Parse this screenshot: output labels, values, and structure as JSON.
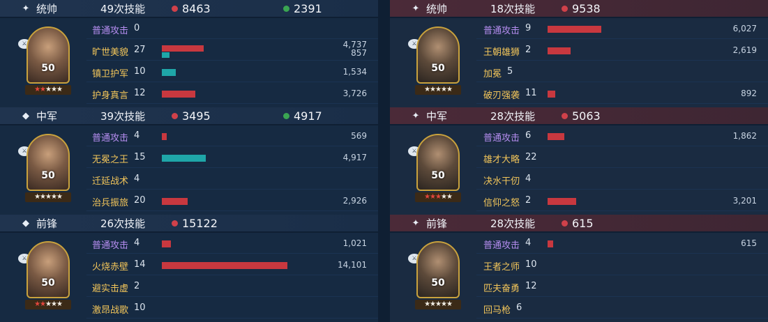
{
  "colors": {
    "damage": "#d0414a",
    "heal": "#3aa552",
    "skill_bar": "#c8383f",
    "heal_bar": "#1fa6a8",
    "normal_attack": "#b58df0",
    "skill_name": "#f2c55a"
  },
  "max_bar_value": 14101,
  "left": [
    {
      "role": "统帅",
      "role_icon": "star-icon",
      "casts": "49次技能",
      "damage": "8463",
      "heal": "2391",
      "level": "50",
      "stars_on": 2,
      "stars_total": 5,
      "skills": [
        {
          "name": "普通攻击",
          "count": "0",
          "type": "normal",
          "dmg": null,
          "heal": null
        },
        {
          "name": "旷世美貌",
          "count": "27",
          "type": "skill",
          "dmg": 4737,
          "heal": 857,
          "dmg_text": "4,737",
          "heal_text": "857"
        },
        {
          "name": "镇卫护军",
          "count": "10",
          "type": "skill",
          "dmg": null,
          "heal": 1534,
          "heal_text": "1,534"
        },
        {
          "name": "护身真言",
          "count": "12",
          "type": "skill",
          "dmg": 3726,
          "heal": null,
          "dmg_text": "3,726"
        }
      ]
    },
    {
      "role": "中军",
      "role_icon": "diamond-icon",
      "casts": "39次技能",
      "damage": "3495",
      "heal": "4917",
      "level": "50",
      "stars_on": 0,
      "stars_total": 5,
      "skills": [
        {
          "name": "普通攻击",
          "count": "4",
          "type": "normal",
          "dmg": 569,
          "heal": null,
          "dmg_text": "569"
        },
        {
          "name": "无冕之王",
          "count": "15",
          "type": "skill",
          "dmg": null,
          "heal": 4917,
          "heal_text": "4,917"
        },
        {
          "name": "迁延战术",
          "count": "4",
          "type": "skill",
          "dmg": null,
          "heal": null
        },
        {
          "name": "治兵振旅",
          "count": "20",
          "type": "skill",
          "dmg": 2926,
          "heal": null,
          "dmg_text": "2,926"
        }
      ]
    },
    {
      "role": "前锋",
      "role_icon": "diamond-icon",
      "casts": "26次技能",
      "damage": "15122",
      "heal": null,
      "level": "50",
      "stars_on": 2,
      "stars_total": 5,
      "skills": [
        {
          "name": "普通攻击",
          "count": "4",
          "type": "normal",
          "dmg": 1021,
          "heal": null,
          "dmg_text": "1,021"
        },
        {
          "name": "火烧赤壁",
          "count": "14",
          "type": "skill",
          "dmg": 14101,
          "heal": null,
          "dmg_text": "14,101"
        },
        {
          "name": "避实击虚",
          "count": "2",
          "type": "skill",
          "dmg": null,
          "heal": null
        },
        {
          "name": "激昂战歌",
          "count": "10",
          "type": "skill",
          "dmg": null,
          "heal": null
        }
      ]
    }
  ],
  "right": [
    {
      "role": "统帅",
      "role_icon": "star-icon",
      "casts": "18次技能",
      "damage": "9538",
      "heal": null,
      "level": "50",
      "stars_on": 0,
      "stars_total": 5,
      "skills": [
        {
          "name": "普通攻击",
          "count": "9",
          "type": "normal",
          "dmg": 6027,
          "heal": null,
          "dmg_text": "6,027"
        },
        {
          "name": "王朝雄狮",
          "count": "2",
          "type": "skill",
          "dmg": 2619,
          "heal": null,
          "dmg_text": "2,619"
        },
        {
          "name": "加冕",
          "count": "5",
          "type": "skill",
          "dmg": null,
          "heal": null
        },
        {
          "name": "破刃强袭",
          "count": "11",
          "type": "skill",
          "dmg": 892,
          "heal": null,
          "dmg_text": "892"
        }
      ]
    },
    {
      "role": "中军",
      "role_icon": "star-icon",
      "casts": "28次技能",
      "damage": "5063",
      "heal": null,
      "level": "50",
      "stars_on": 3,
      "stars_total": 5,
      "skills": [
        {
          "name": "普通攻击",
          "count": "6",
          "type": "normal",
          "dmg": 1862,
          "heal": null,
          "dmg_text": "1,862"
        },
        {
          "name": "雄才大略",
          "count": "22",
          "type": "skill",
          "dmg": null,
          "heal": null
        },
        {
          "name": "决水干仞",
          "count": "4",
          "type": "skill",
          "dmg": null,
          "heal": null
        },
        {
          "name": "信仰之怒",
          "count": "2",
          "type": "skill",
          "dmg": 3201,
          "heal": null,
          "dmg_text": "3,201"
        }
      ]
    },
    {
      "role": "前锋",
      "role_icon": "star-icon",
      "casts": "28次技能",
      "damage": "615",
      "heal": null,
      "level": "50",
      "stars_on": 0,
      "stars_total": 5,
      "skills": [
        {
          "name": "普通攻击",
          "count": "4",
          "type": "normal",
          "dmg": 615,
          "heal": null,
          "dmg_text": "615"
        },
        {
          "name": "王者之师",
          "count": "10",
          "type": "skill",
          "dmg": null,
          "heal": null
        },
        {
          "name": "匹夫奋勇",
          "count": "12",
          "type": "skill",
          "dmg": null,
          "heal": null
        },
        {
          "name": "回马枪",
          "count": "6",
          "type": "skill",
          "dmg": null,
          "heal": null
        }
      ]
    }
  ]
}
